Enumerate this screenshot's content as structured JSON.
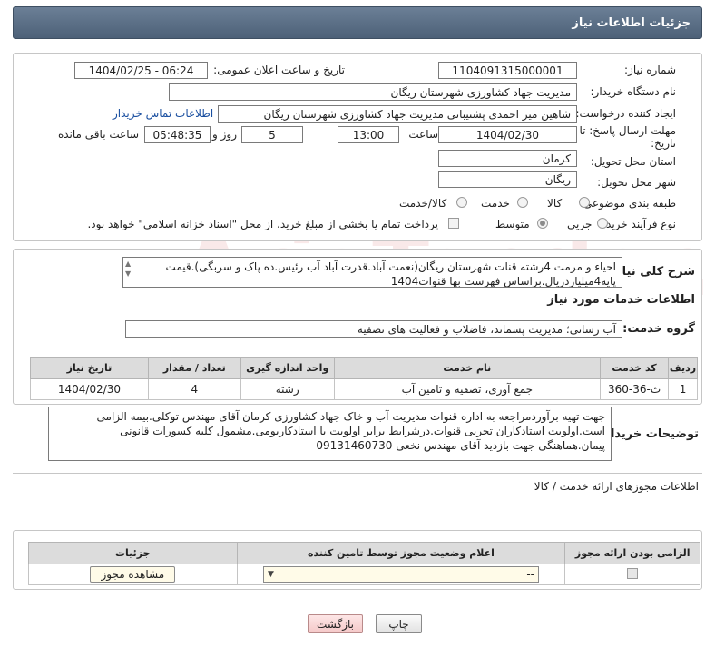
{
  "header": {
    "title": "جزئیات اطلاعات نیاز"
  },
  "form": {
    "need_number_label": "شماره نیاز:",
    "need_number": "1104091315000001",
    "announce_label": "تاریخ و ساعت اعلان عمومی:",
    "announce_value": "1404/02/25 - 06:24",
    "buyer_org_label": "نام دستگاه خریدار:",
    "buyer_org": "مدیریت جهاد کشاورزی شهرستان ریگان",
    "creator_label": "ایجاد کننده درخواست:",
    "creator": "شاهین  میر احمدی پشتیبانی مدیریت جهاد کشاورزی شهرستان ریگان",
    "contact_link": "اطلاعات تماس خریدار",
    "deadline_label_1": "مهلت ارسال پاسخ: تا",
    "deadline_label_2": "تاریخ:",
    "deadline_date": "1404/02/30",
    "time_label": "ساعت",
    "deadline_time": "13:00",
    "days_value": "5",
    "days_label": "روز و",
    "remaining_time": "05:48:35",
    "remaining_label": "ساعت باقی مانده",
    "province_label": "استان محل تحویل:",
    "province": "کرمان",
    "city_label": "شهر محل تحویل:",
    "city": "ریگان",
    "category_label": "طبقه بندی موضوعی:",
    "category_options": [
      "کالا",
      "خدمت",
      "کالا/خدمت"
    ],
    "purchase_type_label": "نوع فرآیند خرید :",
    "purchase_options": [
      "جزیی",
      "متوسط"
    ],
    "payment_note": "پرداخت تمام یا بخشی از مبلغ خرید، از محل \"اسناد خزانه اسلامی\" خواهد بود."
  },
  "summary": {
    "label": "شرح کلی نیاز:",
    "text": "احیاء و مرمت 4رشته قنات شهرستان ریگان(نعمت آباد.قدرت آباد آب رئیس.ده پاک و سربگی).قیمت پایه4میلیاردریال.براساس فهرست بها قنوات1404"
  },
  "services": {
    "section_title": "اطلاعات خدمات مورد نیاز",
    "group_label": "گروه خدمت:",
    "group_value": "آب رسانی؛ مدیریت پسماند، فاضلاب و فعالیت های تصفیه",
    "columns": [
      "ردیف",
      "کد خدمت",
      "نام خدمت",
      "واحد اندازه گیری",
      "تعداد / مقدار",
      "تاریخ نیاز"
    ],
    "rows": [
      [
        "1",
        "ث-36-360",
        "جمع آوری، تصفیه و تامین آب",
        "رشته",
        "4",
        "1404/02/30"
      ]
    ]
  },
  "buyer_notes": {
    "label": "توضیحات خریدار:",
    "text": "جهت تهیه برآوردمراجعه به اداره قنوات مدیریت آب و خاک جهاد کشاورزی کرمان آقای مهندس توکلی.بیمه الزامی است.اولویت استادکاران تجربی قنوات.درشرایط برابر اولویت با استادکاربومی.مشمول کلیه کسورات قانونی پیمان.هماهنگی جهت بازدید آقای مهندس نخعی 09131460730"
  },
  "permits": {
    "section_title": "اطلاعات مجوزهای ارائه خدمت / کالا",
    "columns": [
      "الزامی بودن ارائه مجوز",
      "اعلام وضعیت مجوز توسط تامین کننده",
      "جزئیات"
    ],
    "select_value": "--",
    "view_button": "مشاهده مجوز"
  },
  "footer": {
    "print_button": "چاپ",
    "back_button": "بازگشت"
  },
  "watermark_text": "AriaTender.neT"
}
